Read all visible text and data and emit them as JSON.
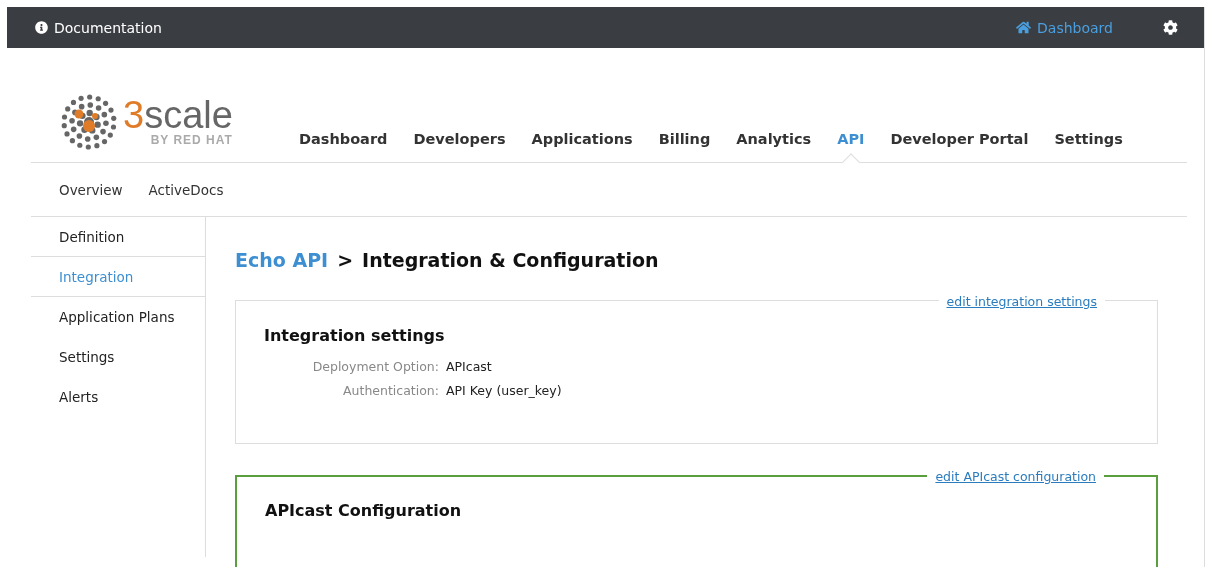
{
  "top_bar": {
    "documentation": "Documentation",
    "dashboard": "Dashboard"
  },
  "logo": {
    "accent": "3",
    "name": "scale",
    "tagline": "BY RED HAT"
  },
  "main_nav": [
    {
      "label": "Dashboard",
      "selected": false
    },
    {
      "label": "Developers",
      "selected": false
    },
    {
      "label": "Applications",
      "selected": false
    },
    {
      "label": "Billing",
      "selected": false
    },
    {
      "label": "Analytics",
      "selected": false
    },
    {
      "label": "API",
      "selected": true
    },
    {
      "label": "Developer Portal",
      "selected": false
    },
    {
      "label": "Settings",
      "selected": false
    }
  ],
  "sub_nav": [
    "Overview",
    "ActiveDocs"
  ],
  "sidebar": {
    "items": [
      {
        "label": "Definition",
        "selected": false
      },
      {
        "label": "Integration",
        "selected": true
      },
      {
        "label": "Application Plans",
        "selected": false
      },
      {
        "label": "Settings",
        "selected": false
      },
      {
        "label": "Alerts",
        "selected": false
      }
    ]
  },
  "breadcrumb": {
    "parent": "Echo API",
    "separator": ">",
    "title": "Integration & Configuration"
  },
  "sections": [
    {
      "title": "Integration settings",
      "edit_link": "edit integration settings",
      "highlighted": false,
      "fields": [
        {
          "label": "Deployment Option:",
          "value": "APIcast"
        },
        {
          "label": "Authentication:",
          "value": "API Key (user_key)"
        }
      ]
    },
    {
      "title": "APIcast Configuration",
      "edit_link": "edit APIcast configuration",
      "highlighted": true
    }
  ]
}
